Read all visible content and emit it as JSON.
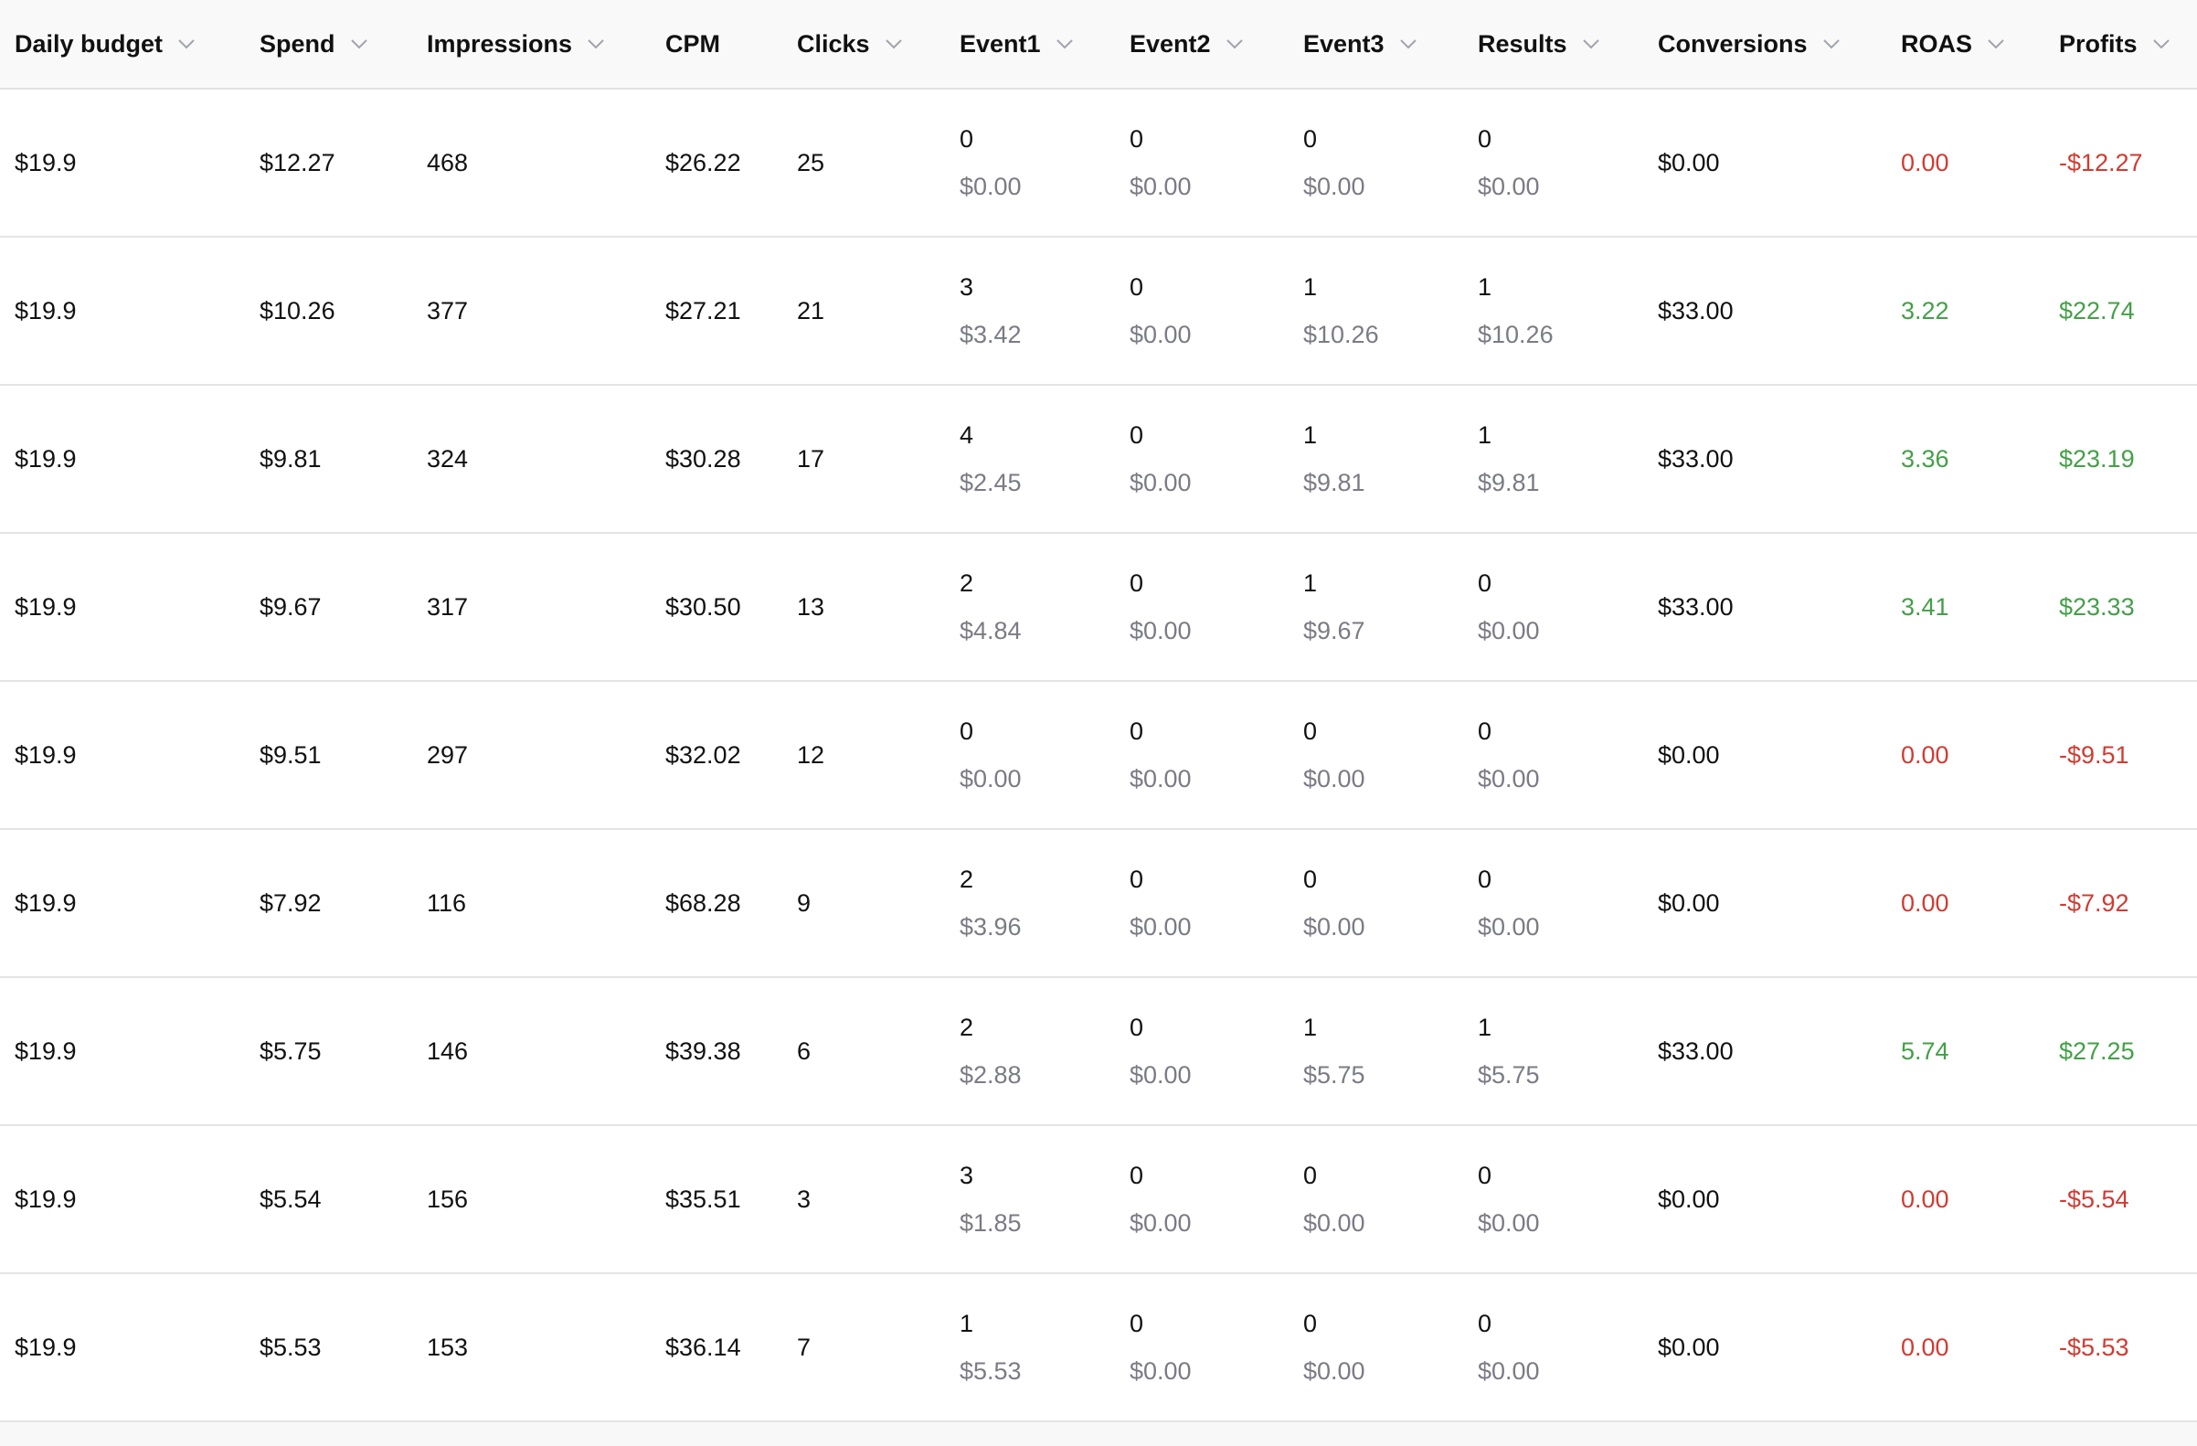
{
  "colors": {
    "positive": "#43a047",
    "negative": "#d13b32",
    "muted": "#7b7b85",
    "header_bg": "#f9f9f9"
  },
  "columns": [
    {
      "key": "daily_budget",
      "label": "Daily budget",
      "sortable": true
    },
    {
      "key": "spend",
      "label": "Spend",
      "sortable": true
    },
    {
      "key": "impressions",
      "label": "Impressions",
      "sortable": true
    },
    {
      "key": "cpm",
      "label": "CPM",
      "sortable": false
    },
    {
      "key": "clicks",
      "label": "Clicks",
      "sortable": true
    },
    {
      "key": "event1",
      "label": "Event1",
      "sortable": true
    },
    {
      "key": "event2",
      "label": "Event2",
      "sortable": true
    },
    {
      "key": "event3",
      "label": "Event3",
      "sortable": true
    },
    {
      "key": "results",
      "label": "Results",
      "sortable": true
    },
    {
      "key": "conversions",
      "label": "Conversions",
      "sortable": true
    },
    {
      "key": "roas",
      "label": "ROAS",
      "sortable": true
    },
    {
      "key": "profits",
      "label": "Profits",
      "sortable": true
    }
  ],
  "rows": [
    {
      "daily_budget": "$19.9",
      "spend": "$12.27",
      "impressions": "468",
      "cpm": "$26.22",
      "clicks": "25",
      "event1": {
        "count": "0",
        "cost": "$0.00"
      },
      "event2": {
        "count": "0",
        "cost": "$0.00"
      },
      "event3": {
        "count": "0",
        "cost": "$0.00"
      },
      "results": {
        "count": "0",
        "cost": "$0.00"
      },
      "conversions": "$0.00",
      "roas": "0.00",
      "profits": "-$12.27",
      "status": "negative"
    },
    {
      "daily_budget": "$19.9",
      "spend": "$10.26",
      "impressions": "377",
      "cpm": "$27.21",
      "clicks": "21",
      "event1": {
        "count": "3",
        "cost": "$3.42"
      },
      "event2": {
        "count": "0",
        "cost": "$0.00"
      },
      "event3": {
        "count": "1",
        "cost": "$10.26"
      },
      "results": {
        "count": "1",
        "cost": "$10.26"
      },
      "conversions": "$33.00",
      "roas": "3.22",
      "profits": "$22.74",
      "status": "positive"
    },
    {
      "daily_budget": "$19.9",
      "spend": "$9.81",
      "impressions": "324",
      "cpm": "$30.28",
      "clicks": "17",
      "event1": {
        "count": "4",
        "cost": "$2.45"
      },
      "event2": {
        "count": "0",
        "cost": "$0.00"
      },
      "event3": {
        "count": "1",
        "cost": "$9.81"
      },
      "results": {
        "count": "1",
        "cost": "$9.81"
      },
      "conversions": "$33.00",
      "roas": "3.36",
      "profits": "$23.19",
      "status": "positive"
    },
    {
      "daily_budget": "$19.9",
      "spend": "$9.67",
      "impressions": "317",
      "cpm": "$30.50",
      "clicks": "13",
      "event1": {
        "count": "2",
        "cost": "$4.84"
      },
      "event2": {
        "count": "0",
        "cost": "$0.00"
      },
      "event3": {
        "count": "1",
        "cost": "$9.67"
      },
      "results": {
        "count": "0",
        "cost": "$0.00"
      },
      "conversions": "$33.00",
      "roas": "3.41",
      "profits": "$23.33",
      "status": "positive"
    },
    {
      "daily_budget": "$19.9",
      "spend": "$9.51",
      "impressions": "297",
      "cpm": "$32.02",
      "clicks": "12",
      "event1": {
        "count": "0",
        "cost": "$0.00"
      },
      "event2": {
        "count": "0",
        "cost": "$0.00"
      },
      "event3": {
        "count": "0",
        "cost": "$0.00"
      },
      "results": {
        "count": "0",
        "cost": "$0.00"
      },
      "conversions": "$0.00",
      "roas": "0.00",
      "profits": "-$9.51",
      "status": "negative"
    },
    {
      "daily_budget": "$19.9",
      "spend": "$7.92",
      "impressions": "116",
      "cpm": "$68.28",
      "clicks": "9",
      "event1": {
        "count": "2",
        "cost": "$3.96"
      },
      "event2": {
        "count": "0",
        "cost": "$0.00"
      },
      "event3": {
        "count": "0",
        "cost": "$0.00"
      },
      "results": {
        "count": "0",
        "cost": "$0.00"
      },
      "conversions": "$0.00",
      "roas": "0.00",
      "profits": "-$7.92",
      "status": "negative"
    },
    {
      "daily_budget": "$19.9",
      "spend": "$5.75",
      "impressions": "146",
      "cpm": "$39.38",
      "clicks": "6",
      "event1": {
        "count": "2",
        "cost": "$2.88"
      },
      "event2": {
        "count": "0",
        "cost": "$0.00"
      },
      "event3": {
        "count": "1",
        "cost": "$5.75"
      },
      "results": {
        "count": "1",
        "cost": "$5.75"
      },
      "conversions": "$33.00",
      "roas": "5.74",
      "profits": "$27.25",
      "status": "positive"
    },
    {
      "daily_budget": "$19.9",
      "spend": "$5.54",
      "impressions": "156",
      "cpm": "$35.51",
      "clicks": "3",
      "event1": {
        "count": "3",
        "cost": "$1.85"
      },
      "event2": {
        "count": "0",
        "cost": "$0.00"
      },
      "event3": {
        "count": "0",
        "cost": "$0.00"
      },
      "results": {
        "count": "0",
        "cost": "$0.00"
      },
      "conversions": "$0.00",
      "roas": "0.00",
      "profits": "-$5.54",
      "status": "negative"
    },
    {
      "daily_budget": "$19.9",
      "spend": "$5.53",
      "impressions": "153",
      "cpm": "$36.14",
      "clicks": "7",
      "event1": {
        "count": "1",
        "cost": "$5.53"
      },
      "event2": {
        "count": "0",
        "cost": "$0.00"
      },
      "event3": {
        "count": "0",
        "cost": "$0.00"
      },
      "results": {
        "count": "0",
        "cost": "$0.00"
      },
      "conversions": "$0.00",
      "roas": "0.00",
      "profits": "-$5.53",
      "status": "negative"
    }
  ]
}
